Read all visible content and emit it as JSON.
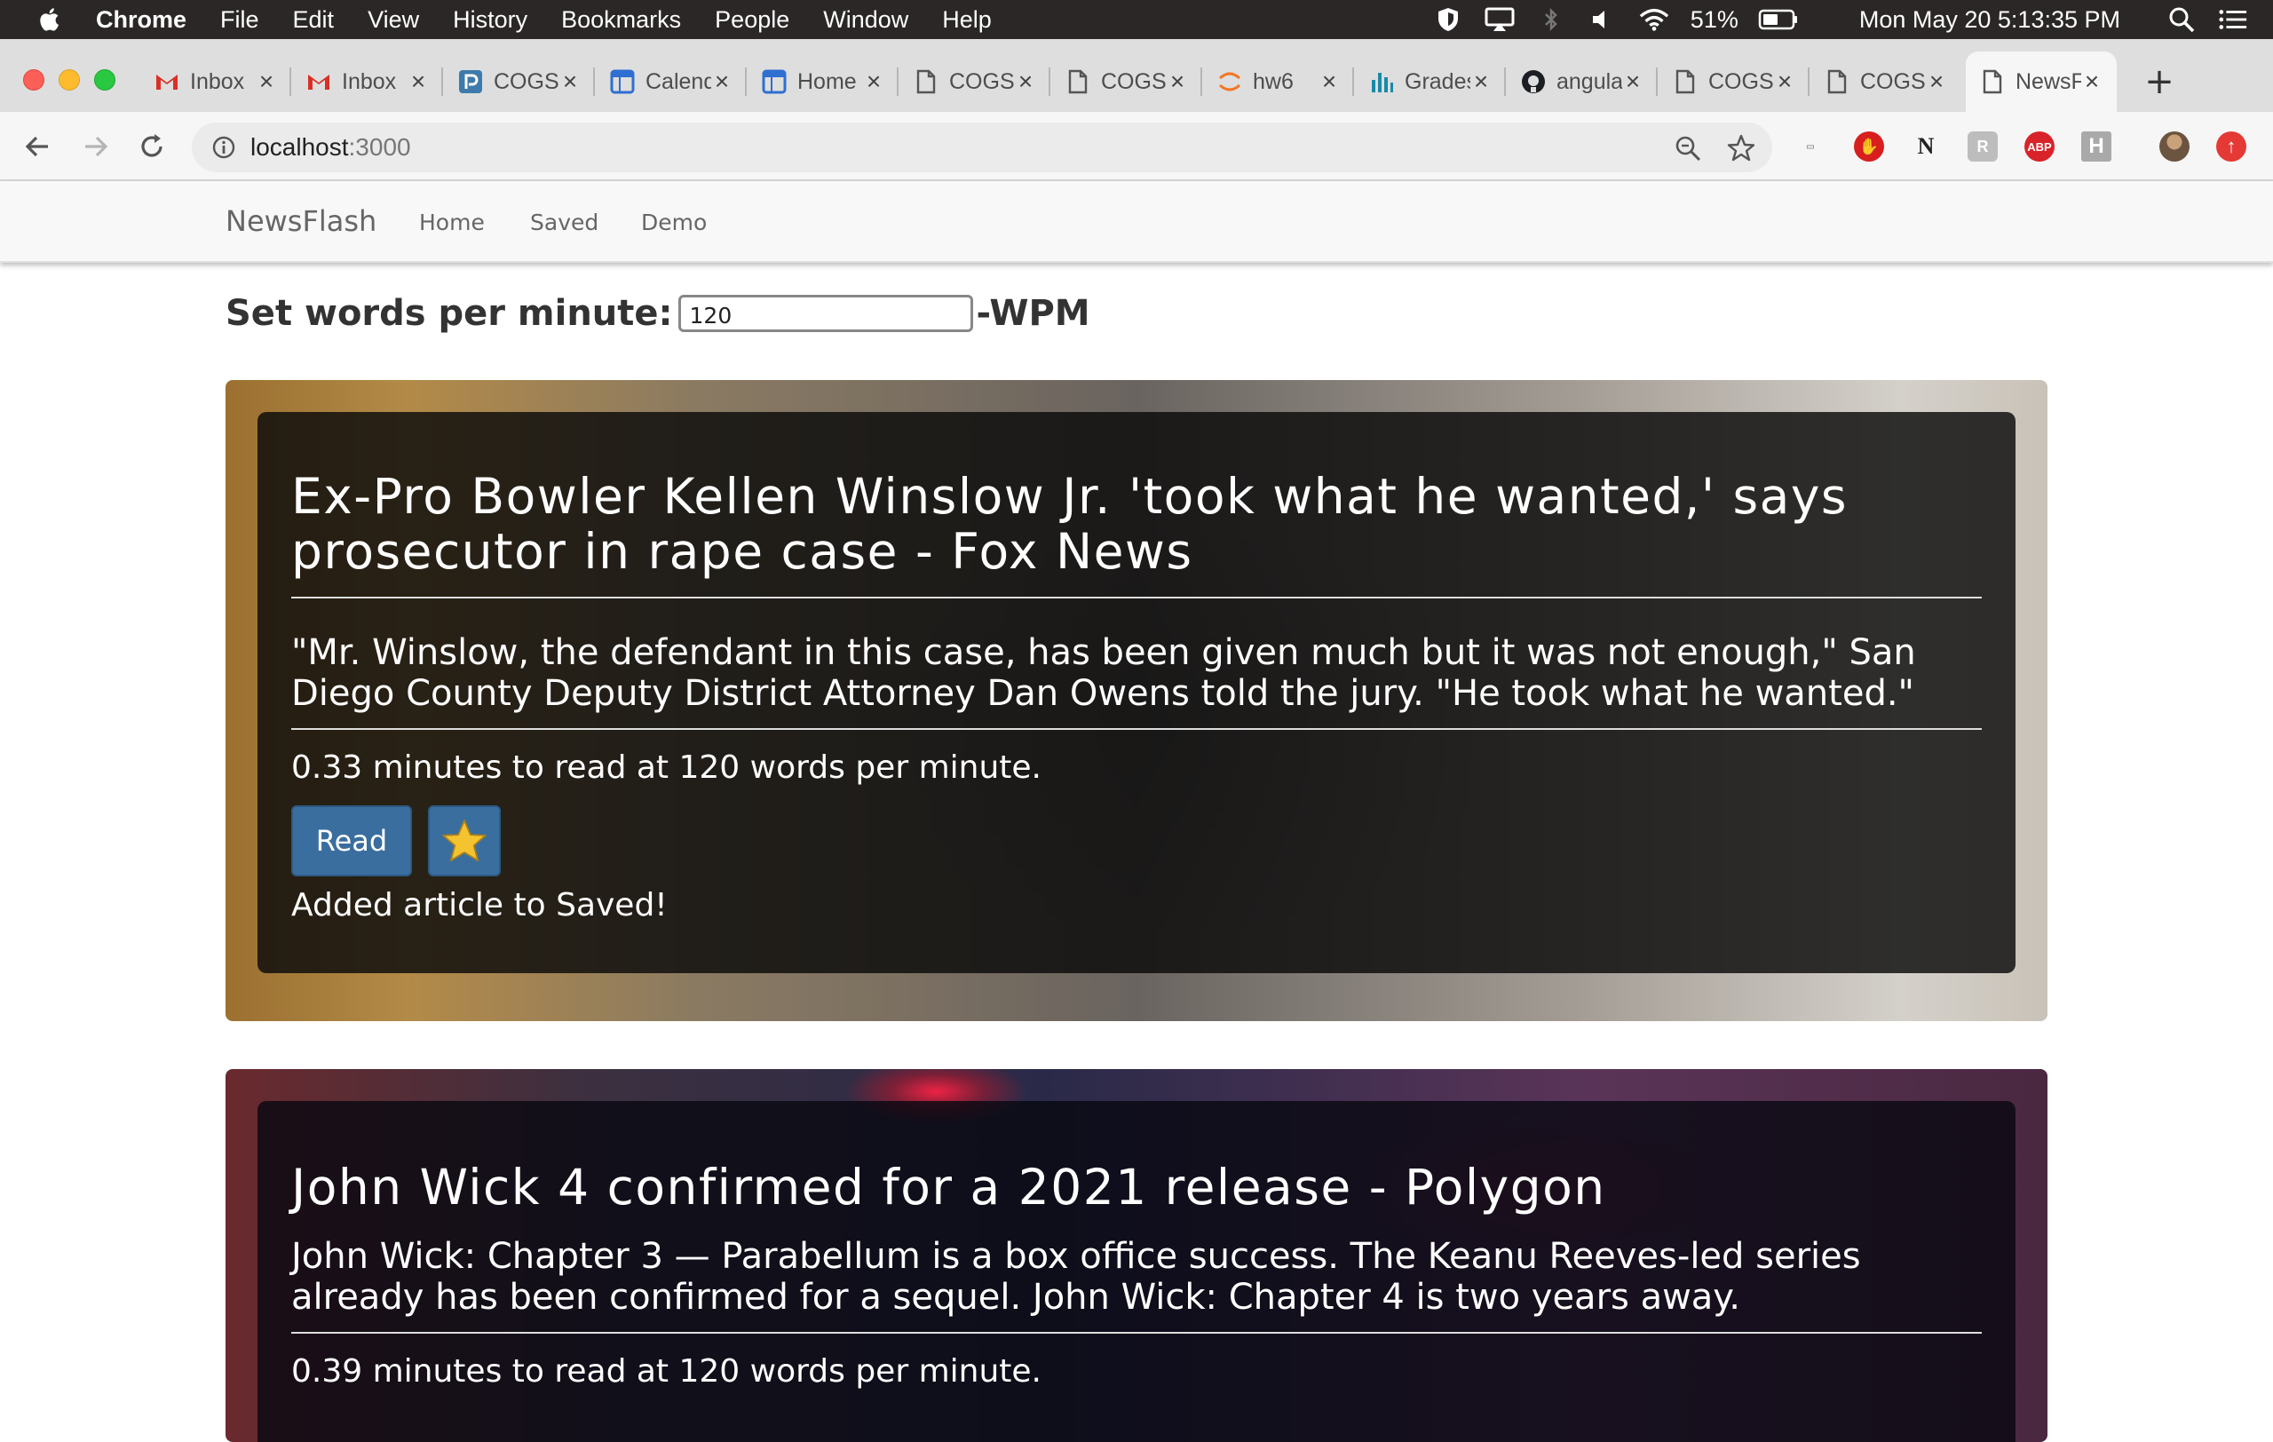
{
  "menubar": {
    "app_name": "Chrome",
    "items": [
      "File",
      "Edit",
      "View",
      "History",
      "Bookmarks",
      "People",
      "Window",
      "Help"
    ],
    "battery": "51%",
    "clock": "Mon May 20  5:13:35 PM"
  },
  "tabs": [
    {
      "title": "Inbox",
      "icon": "gmail-icon"
    },
    {
      "title": "Inbox",
      "icon": "gmail-icon"
    },
    {
      "title": "COGS",
      "icon": "piazza-icon"
    },
    {
      "title": "Calendar",
      "icon": "calendar-icon"
    },
    {
      "title": "Home",
      "icon": "calendar-icon"
    },
    {
      "title": "COGS",
      "icon": "document-icon"
    },
    {
      "title": "COGS",
      "icon": "document-icon"
    },
    {
      "title": "hw6",
      "icon": "jupyter-icon"
    },
    {
      "title": "Grades",
      "icon": "bar-chart-icon"
    },
    {
      "title": "angular",
      "icon": "github-icon"
    },
    {
      "title": "COGS",
      "icon": "document-icon"
    },
    {
      "title": "COGS",
      "icon": "document-icon"
    },
    {
      "title": "NewsFlash",
      "icon": "document-icon",
      "active": true
    }
  ],
  "address_bar": {
    "host": "localhost",
    "port": ":3000"
  },
  "extensions": [
    {
      "name": "outline-extension-icon",
      "label": "",
      "color": "#bbbbbb"
    },
    {
      "name": "stop-hand-extension-icon",
      "label": "",
      "color": "#d81e1e"
    },
    {
      "name": "ni-extension-icon",
      "label": "N",
      "color": "#ffffff"
    },
    {
      "name": "hoarder-extension-icon",
      "label": "R",
      "color": "#bdbdbd"
    },
    {
      "name": "adblock-plus-icon",
      "label": "ABP",
      "color": "#d8232a"
    },
    {
      "name": "h-extension-icon",
      "label": "H",
      "color": "#a9a9a9"
    }
  ],
  "app": {
    "brand": "NewsFlash",
    "nav": [
      "Home",
      "Saved",
      "Demo"
    ],
    "wpm_label": "Set words per minute:",
    "wpm_value": "120",
    "wpm_unit": "-WPM"
  },
  "articles": [
    {
      "title": "Ex-Pro Bowler Kellen Winslow Jr. 'took what he wanted,' says prosecutor in rape case - Fox News",
      "description": "\"Mr. Winslow, the defendant in this case, has been given much but it was not enough,\" San Diego County Deputy District Attorney Dan Owens told the jury. \"He took what he wanted.\"",
      "read_time": "0.33 minutes to read at 120 words per minute.",
      "read_label": "Read",
      "saved_message": "Added article to Saved!"
    },
    {
      "title": "John Wick 4 confirmed for a 2021 release - Polygon",
      "description": "John Wick: Chapter 3 — Parabellum is a box office success. The Keanu Reeves-led series already has been confirmed for a sequel. John Wick: Chapter 4 is two years away.",
      "read_time": "0.39 minutes to read at 120 words per minute."
    }
  ],
  "colors": {
    "read_button": "#3a6e9e",
    "star": "#f4c430",
    "menubar": "#2a2726"
  }
}
